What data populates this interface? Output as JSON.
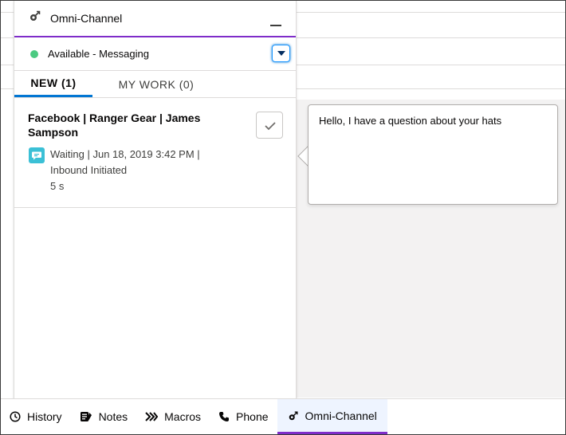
{
  "panel": {
    "title": "Omni-Channel",
    "status_text": "Available - Messaging",
    "status_color": "#4bca81",
    "accent_color": "#7f2dc9",
    "tabs": [
      {
        "label": "NEW (1)",
        "active": true
      },
      {
        "label": "MY WORK (0)",
        "active": false
      }
    ]
  },
  "work_item": {
    "title": "Facebook | Ranger Gear | James Sampson",
    "icon": "messaging-icon",
    "meta_line1": "Waiting | Jun 18, 2019 3:42 PM |",
    "meta_line2": "Inbound Initiated",
    "elapsed": "5 s"
  },
  "preview": {
    "message": "Hello, I have a question about your hats"
  },
  "utility_bar": {
    "items": [
      {
        "label": "History",
        "icon": "clock-icon"
      },
      {
        "label": "Notes",
        "icon": "notes-icon"
      },
      {
        "label": "Macros",
        "icon": "macros-icon"
      },
      {
        "label": "Phone",
        "icon": "phone-icon"
      },
      {
        "label": "Omni-Channel",
        "icon": "omni-channel-icon",
        "active": true
      }
    ]
  }
}
